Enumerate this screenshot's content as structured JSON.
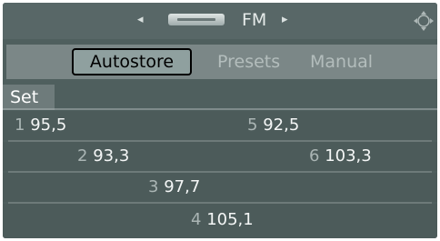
{
  "header": {
    "title": "FM",
    "nav_left": "◂",
    "nav_right": "▸"
  },
  "tabs": [
    {
      "label": "Autostore",
      "selected": true
    },
    {
      "label": "Presets",
      "selected": false
    },
    {
      "label": "Manual",
      "selected": false
    }
  ],
  "set_label": "Set",
  "stations": [
    {
      "number": "1",
      "frequency": "95,5"
    },
    {
      "number": "2",
      "frequency": "93,3"
    },
    {
      "number": "3",
      "frequency": "97,7"
    },
    {
      "number": "4",
      "frequency": "105,1"
    },
    {
      "number": "5",
      "frequency": "92,5"
    },
    {
      "number": "6",
      "frequency": "103,3"
    }
  ],
  "colors": {
    "background": "#4f5f5e",
    "tab_bar": "#7b8787",
    "selected_tab": "#8fa09f",
    "text": "#f4f6f6"
  }
}
